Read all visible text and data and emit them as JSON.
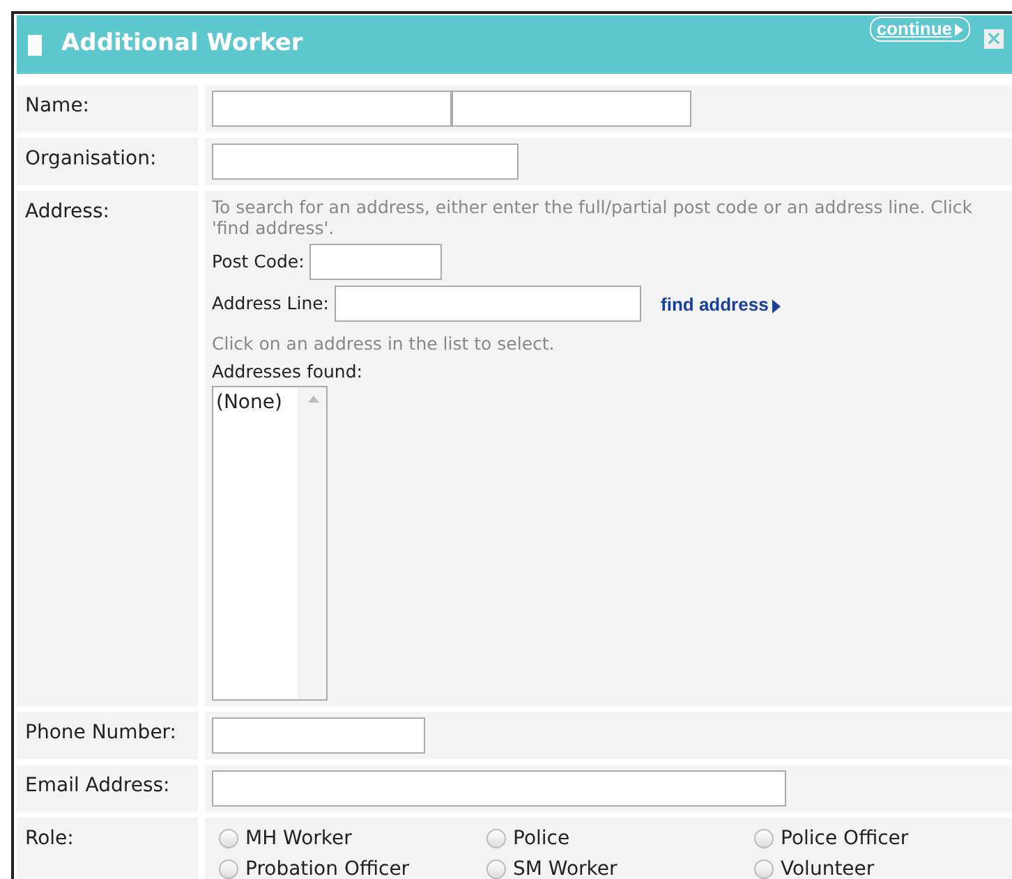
{
  "window": {
    "title": "Additional Worker",
    "continue": "continue",
    "close": "×"
  },
  "fields": [
    {
      "label": "Name:",
      "kind": "name"
    },
    {
      "label": "Organisation:",
      "kind": "text"
    },
    {
      "label": "Address:",
      "kind": "address"
    },
    {
      "label": "Phone Number:",
      "kind": "phone"
    },
    {
      "label": "Email Address:",
      "kind": "email"
    },
    {
      "label": "Role:",
      "kind": "role"
    }
  ],
  "address": {
    "hint": "To search for an address, either enter the full/partial post code or an address line. Click 'find address'.",
    "post_code_label": "Post Code:",
    "address_line_label": "Address Line:",
    "find_link": "find address",
    "list_hint": "Click on an address in the list to select.",
    "found_label": "Addresses found:",
    "found_items": [
      "(None)"
    ]
  },
  "roles": [
    {
      "label": "MH Worker",
      "selected": false
    },
    {
      "label": "Police",
      "selected": false
    },
    {
      "label": "Police Officer",
      "selected": false
    },
    {
      "label": "Probation Officer",
      "selected": false
    },
    {
      "label": "SM Worker",
      "selected": false
    },
    {
      "label": "Volunteer",
      "selected": false
    }
  ]
}
